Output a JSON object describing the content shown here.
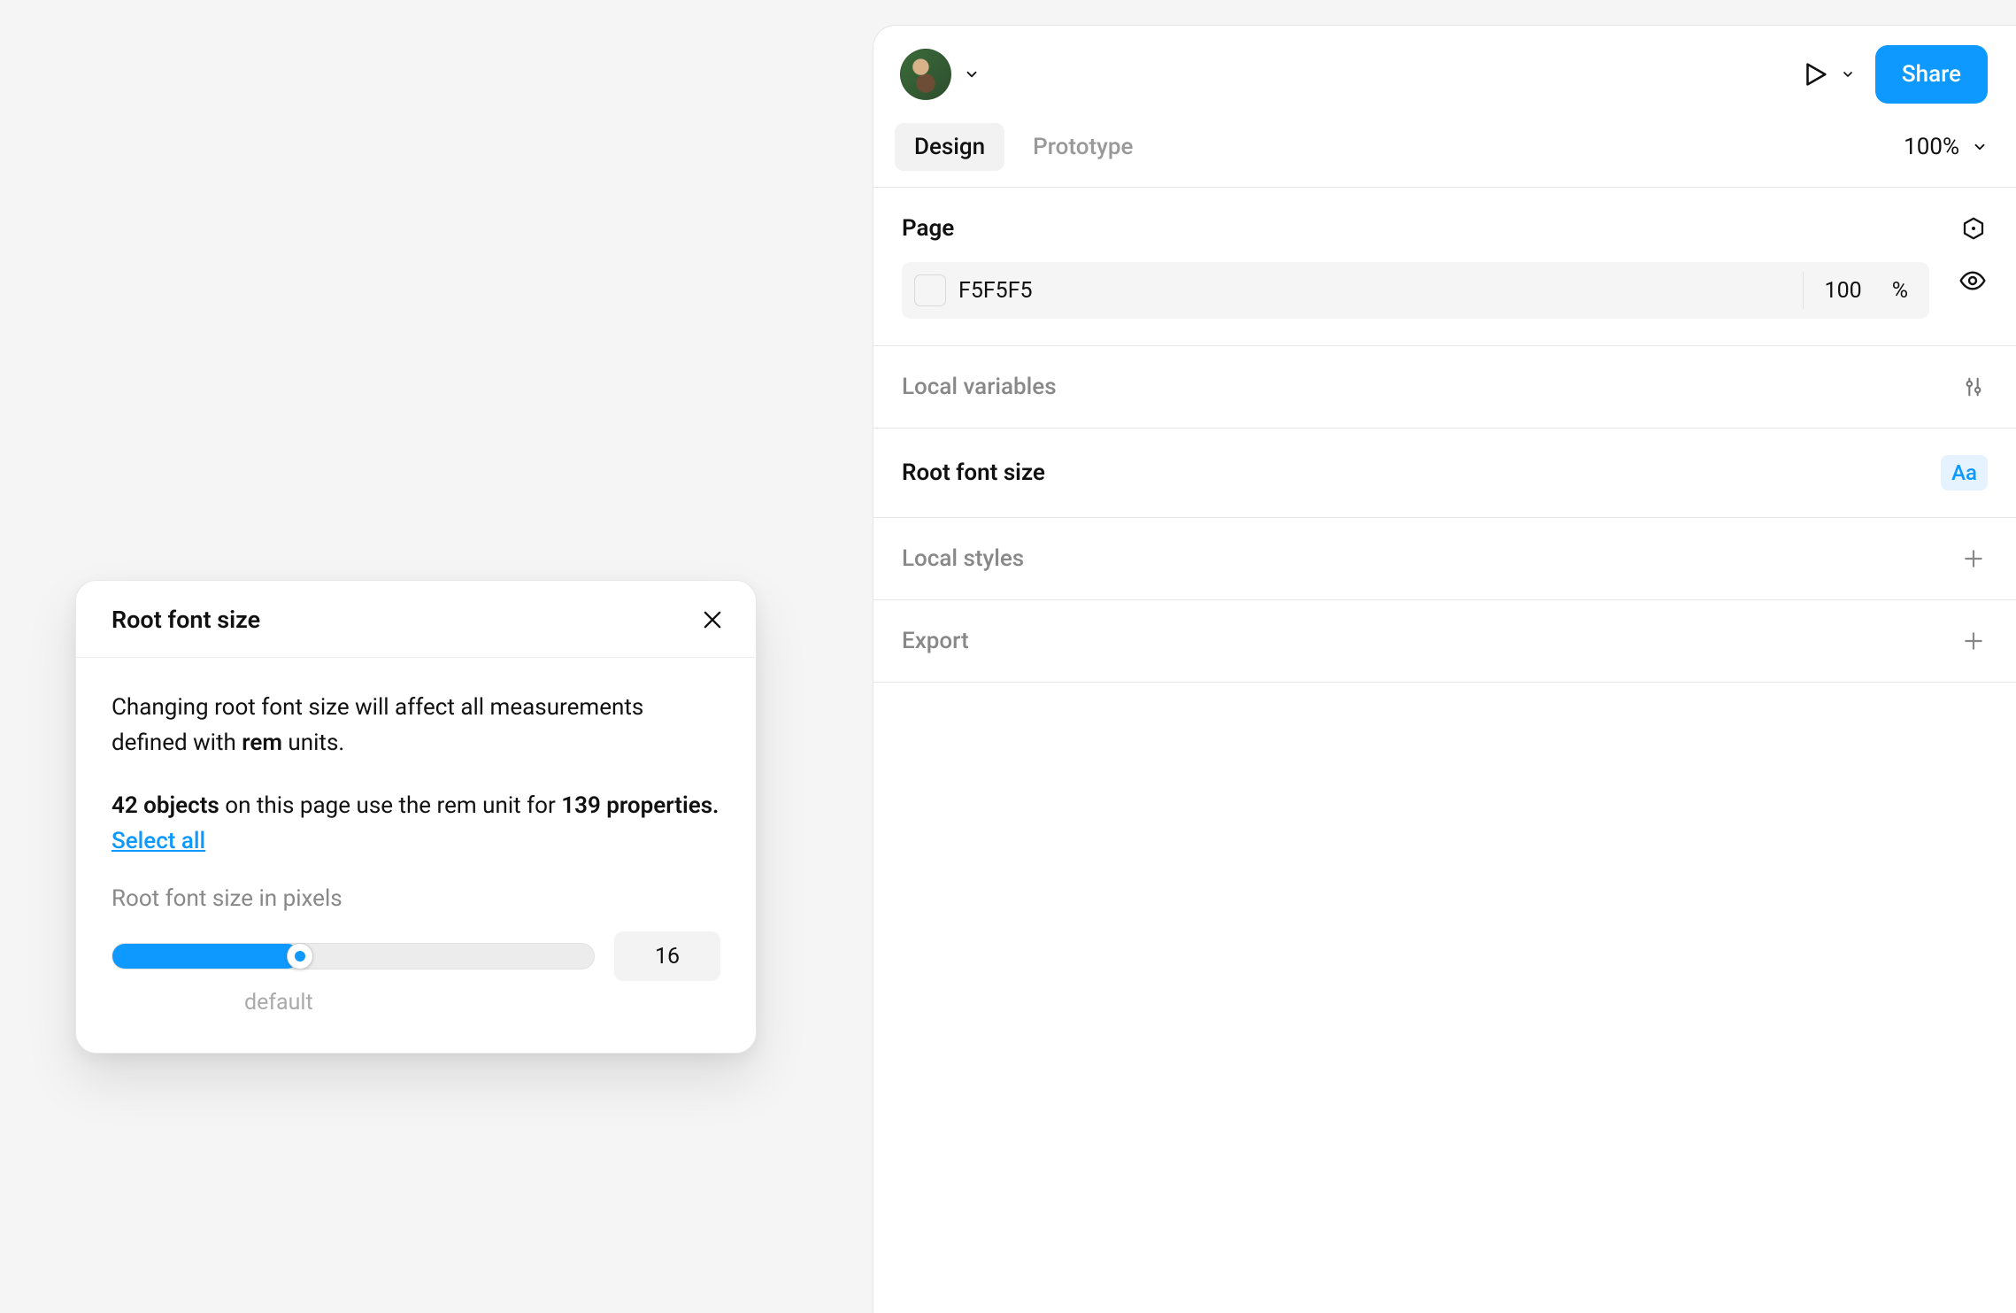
{
  "modal": {
    "title": "Root font size",
    "desc_prefix": "Changing root font size will affect all measurements defined with ",
    "desc_bold": "rem",
    "desc_suffix": " units.",
    "stats_bold1": "42 objects",
    "stats_mid": " on this page use the rem unit for ",
    "stats_bold2": "139 properties.",
    "select_all": "Select all",
    "slider_label": "Root font size in pixels",
    "slider_value": "16",
    "slider_default_label": "default"
  },
  "header": {
    "share": "Share"
  },
  "tabs": {
    "design": "Design",
    "prototype": "Prototype",
    "zoom": "100%"
  },
  "page": {
    "title": "Page",
    "color_hex": "F5F5F5",
    "opacity_value": "100",
    "opacity_unit": "%"
  },
  "sections": {
    "local_variables": "Local variables",
    "root_font_size": "Root font size",
    "aa_badge": "Aa",
    "local_styles": "Local styles",
    "export": "Export"
  }
}
